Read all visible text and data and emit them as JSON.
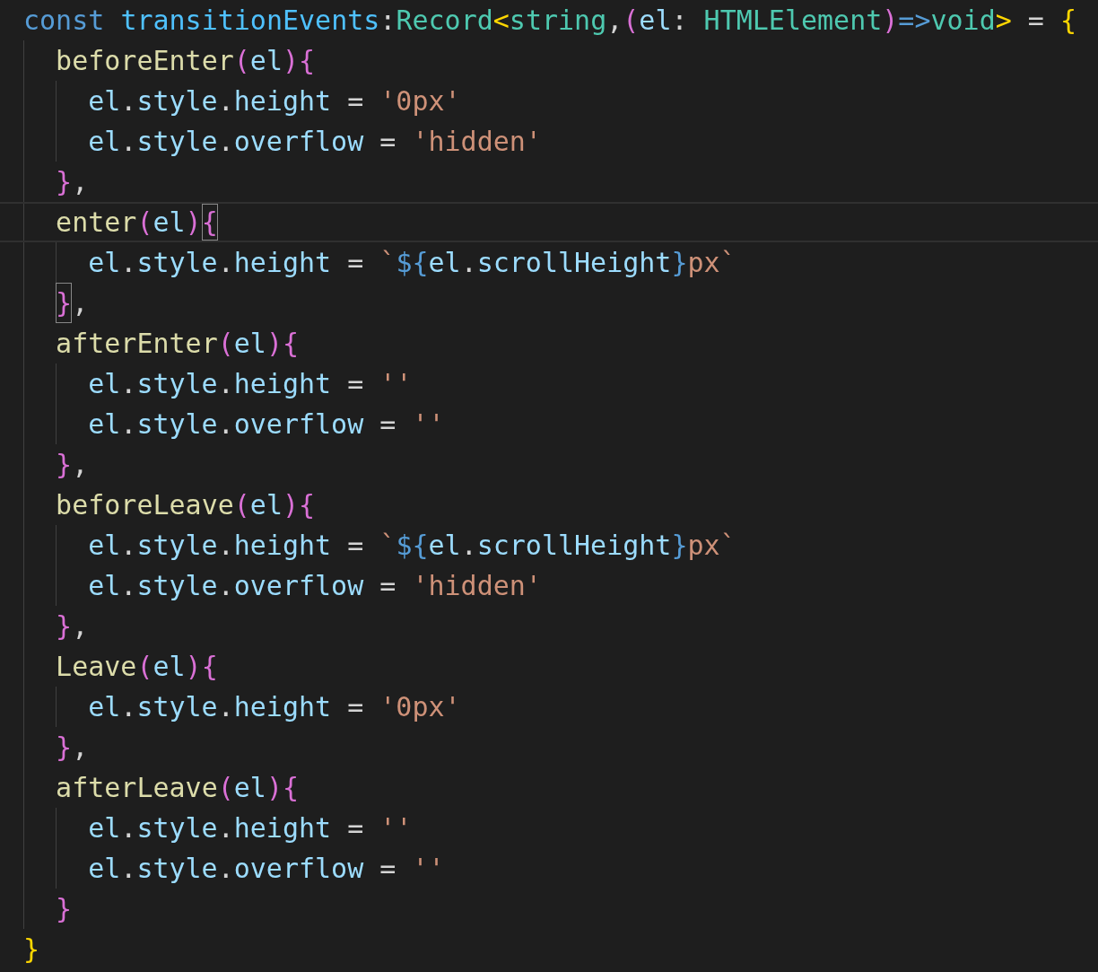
{
  "lines": [
    {
      "tokens": [
        {
          "kind": "kw",
          "text": "const "
        },
        {
          "kind": "const",
          "text": "transitionEvents"
        },
        {
          "kind": "op",
          "text": ":"
        },
        {
          "kind": "type",
          "text": "Record"
        },
        {
          "kind": "b1",
          "text": "<"
        },
        {
          "kind": "type",
          "text": "string"
        },
        {
          "kind": "op",
          "text": ","
        },
        {
          "kind": "b2",
          "text": "("
        },
        {
          "kind": "var",
          "text": "el"
        },
        {
          "kind": "op",
          "text": ": "
        },
        {
          "kind": "type",
          "text": "HTMLElement"
        },
        {
          "kind": "b2",
          "text": ")"
        },
        {
          "kind": "kw",
          "text": "=>"
        },
        {
          "kind": "type",
          "text": "void"
        },
        {
          "kind": "b1",
          "text": ">"
        },
        {
          "kind": "op",
          "text": " = "
        },
        {
          "kind": "b1",
          "text": "{"
        }
      ],
      "children": [
        {
          "tokens": [
            {
              "kind": "fn",
              "text": "beforeEnter"
            },
            {
              "kind": "b2",
              "text": "("
            },
            {
              "kind": "var",
              "text": "el"
            },
            {
              "kind": "b2",
              "text": ")"
            },
            {
              "kind": "b2",
              "text": "{"
            }
          ],
          "children": [
            {
              "tokens": [
                {
                  "kind": "var",
                  "text": "el"
                },
                {
                  "kind": "op",
                  "text": "."
                },
                {
                  "kind": "var",
                  "text": "style"
                },
                {
                  "kind": "op",
                  "text": "."
                },
                {
                  "kind": "var",
                  "text": "height"
                },
                {
                  "kind": "op",
                  "text": " = "
                },
                {
                  "kind": "str",
                  "text": "'0px'"
                }
              ]
            },
            {
              "tokens": [
                {
                  "kind": "var",
                  "text": "el"
                },
                {
                  "kind": "op",
                  "text": "."
                },
                {
                  "kind": "var",
                  "text": "style"
                },
                {
                  "kind": "op",
                  "text": "."
                },
                {
                  "kind": "var",
                  "text": "overflow"
                },
                {
                  "kind": "op",
                  "text": " = "
                },
                {
                  "kind": "str",
                  "text": "'hidden'"
                }
              ]
            }
          ]
        },
        {
          "tokens": [
            {
              "kind": "b2",
              "text": "}"
            },
            {
              "kind": "op",
              "text": ","
            }
          ]
        },
        {
          "current": true,
          "tokens": [
            {
              "kind": "fn",
              "text": "enter"
            },
            {
              "kind": "b2",
              "text": "("
            },
            {
              "kind": "var",
              "text": "el"
            },
            {
              "kind": "b2",
              "text": ")"
            },
            {
              "kind": "b2",
              "text": "{",
              "matched": true
            }
          ],
          "children": [
            {
              "tokens": [
                {
                  "kind": "var",
                  "text": "el"
                },
                {
                  "kind": "op",
                  "text": "."
                },
                {
                  "kind": "var",
                  "text": "style"
                },
                {
                  "kind": "op",
                  "text": "."
                },
                {
                  "kind": "var",
                  "text": "height"
                },
                {
                  "kind": "op",
                  "text": " = "
                },
                {
                  "kind": "str",
                  "text": "`"
                },
                {
                  "kind": "tpl",
                  "text": "${"
                },
                {
                  "kind": "var",
                  "text": "el"
                },
                {
                  "kind": "op",
                  "text": "."
                },
                {
                  "kind": "var",
                  "text": "scrollHeight"
                },
                {
                  "kind": "tpl",
                  "text": "}"
                },
                {
                  "kind": "str",
                  "text": "px`"
                }
              ]
            }
          ]
        },
        {
          "tokens": [
            {
              "kind": "b2",
              "text": "}",
              "matched": true
            },
            {
              "kind": "op",
              "text": ","
            }
          ]
        },
        {
          "tokens": [
            {
              "kind": "fn",
              "text": "afterEnter"
            },
            {
              "kind": "b2",
              "text": "("
            },
            {
              "kind": "var",
              "text": "el"
            },
            {
              "kind": "b2",
              "text": ")"
            },
            {
              "kind": "b2",
              "text": "{"
            }
          ],
          "children": [
            {
              "tokens": [
                {
                  "kind": "var",
                  "text": "el"
                },
                {
                  "kind": "op",
                  "text": "."
                },
                {
                  "kind": "var",
                  "text": "style"
                },
                {
                  "kind": "op",
                  "text": "."
                },
                {
                  "kind": "var",
                  "text": "height"
                },
                {
                  "kind": "op",
                  "text": " = "
                },
                {
                  "kind": "str",
                  "text": "''"
                }
              ]
            },
            {
              "tokens": [
                {
                  "kind": "var",
                  "text": "el"
                },
                {
                  "kind": "op",
                  "text": "."
                },
                {
                  "kind": "var",
                  "text": "style"
                },
                {
                  "kind": "op",
                  "text": "."
                },
                {
                  "kind": "var",
                  "text": "overflow"
                },
                {
                  "kind": "op",
                  "text": " = "
                },
                {
                  "kind": "str",
                  "text": "''"
                }
              ]
            }
          ]
        },
        {
          "tokens": [
            {
              "kind": "b2",
              "text": "}"
            },
            {
              "kind": "op",
              "text": ","
            }
          ]
        },
        {
          "tokens": [
            {
              "kind": "fn",
              "text": "beforeLeave"
            },
            {
              "kind": "b2",
              "text": "("
            },
            {
              "kind": "var",
              "text": "el"
            },
            {
              "kind": "b2",
              "text": ")"
            },
            {
              "kind": "b2",
              "text": "{"
            }
          ],
          "children": [
            {
              "tokens": [
                {
                  "kind": "var",
                  "text": "el"
                },
                {
                  "kind": "op",
                  "text": "."
                },
                {
                  "kind": "var",
                  "text": "style"
                },
                {
                  "kind": "op",
                  "text": "."
                },
                {
                  "kind": "var",
                  "text": "height"
                },
                {
                  "kind": "op",
                  "text": " = "
                },
                {
                  "kind": "str",
                  "text": "`"
                },
                {
                  "kind": "tpl",
                  "text": "${"
                },
                {
                  "kind": "var",
                  "text": "el"
                },
                {
                  "kind": "op",
                  "text": "."
                },
                {
                  "kind": "var",
                  "text": "scrollHeight"
                },
                {
                  "kind": "tpl",
                  "text": "}"
                },
                {
                  "kind": "str",
                  "text": "px`"
                }
              ]
            },
            {
              "tokens": [
                {
                  "kind": "var",
                  "text": "el"
                },
                {
                  "kind": "op",
                  "text": "."
                },
                {
                  "kind": "var",
                  "text": "style"
                },
                {
                  "kind": "op",
                  "text": "."
                },
                {
                  "kind": "var",
                  "text": "overflow"
                },
                {
                  "kind": "op",
                  "text": " = "
                },
                {
                  "kind": "str",
                  "text": "'hidden'"
                }
              ]
            }
          ]
        },
        {
          "tokens": [
            {
              "kind": "b2",
              "text": "}"
            },
            {
              "kind": "op",
              "text": ","
            }
          ]
        },
        {
          "tokens": [
            {
              "kind": "fn",
              "text": "Leave"
            },
            {
              "kind": "b2",
              "text": "("
            },
            {
              "kind": "var",
              "text": "el"
            },
            {
              "kind": "b2",
              "text": ")"
            },
            {
              "kind": "b2",
              "text": "{"
            }
          ],
          "children": [
            {
              "tokens": [
                {
                  "kind": "var",
                  "text": "el"
                },
                {
                  "kind": "op",
                  "text": "."
                },
                {
                  "kind": "var",
                  "text": "style"
                },
                {
                  "kind": "op",
                  "text": "."
                },
                {
                  "kind": "var",
                  "text": "height"
                },
                {
                  "kind": "op",
                  "text": " = "
                },
                {
                  "kind": "str",
                  "text": "'0px'"
                }
              ]
            }
          ]
        },
        {
          "tokens": [
            {
              "kind": "b2",
              "text": "}"
            },
            {
              "kind": "op",
              "text": ","
            }
          ]
        },
        {
          "tokens": [
            {
              "kind": "fn",
              "text": "afterLeave"
            },
            {
              "kind": "b2",
              "text": "("
            },
            {
              "kind": "var",
              "text": "el"
            },
            {
              "kind": "b2",
              "text": ")"
            },
            {
              "kind": "b2",
              "text": "{"
            }
          ],
          "children": [
            {
              "tokens": [
                {
                  "kind": "var",
                  "text": "el"
                },
                {
                  "kind": "op",
                  "text": "."
                },
                {
                  "kind": "var",
                  "text": "style"
                },
                {
                  "kind": "op",
                  "text": "."
                },
                {
                  "kind": "var",
                  "text": "height"
                },
                {
                  "kind": "op",
                  "text": " = "
                },
                {
                  "kind": "str",
                  "text": "''"
                }
              ]
            },
            {
              "tokens": [
                {
                  "kind": "var",
                  "text": "el"
                },
                {
                  "kind": "op",
                  "text": "."
                },
                {
                  "kind": "var",
                  "text": "style"
                },
                {
                  "kind": "op",
                  "text": "."
                },
                {
                  "kind": "var",
                  "text": "overflow"
                },
                {
                  "kind": "op",
                  "text": " = "
                },
                {
                  "kind": "str",
                  "text": "''"
                }
              ]
            }
          ]
        },
        {
          "tokens": [
            {
              "kind": "b2",
              "text": "}"
            }
          ]
        }
      ]
    },
    {
      "tokens": [
        {
          "kind": "b1",
          "text": "}"
        }
      ]
    }
  ]
}
